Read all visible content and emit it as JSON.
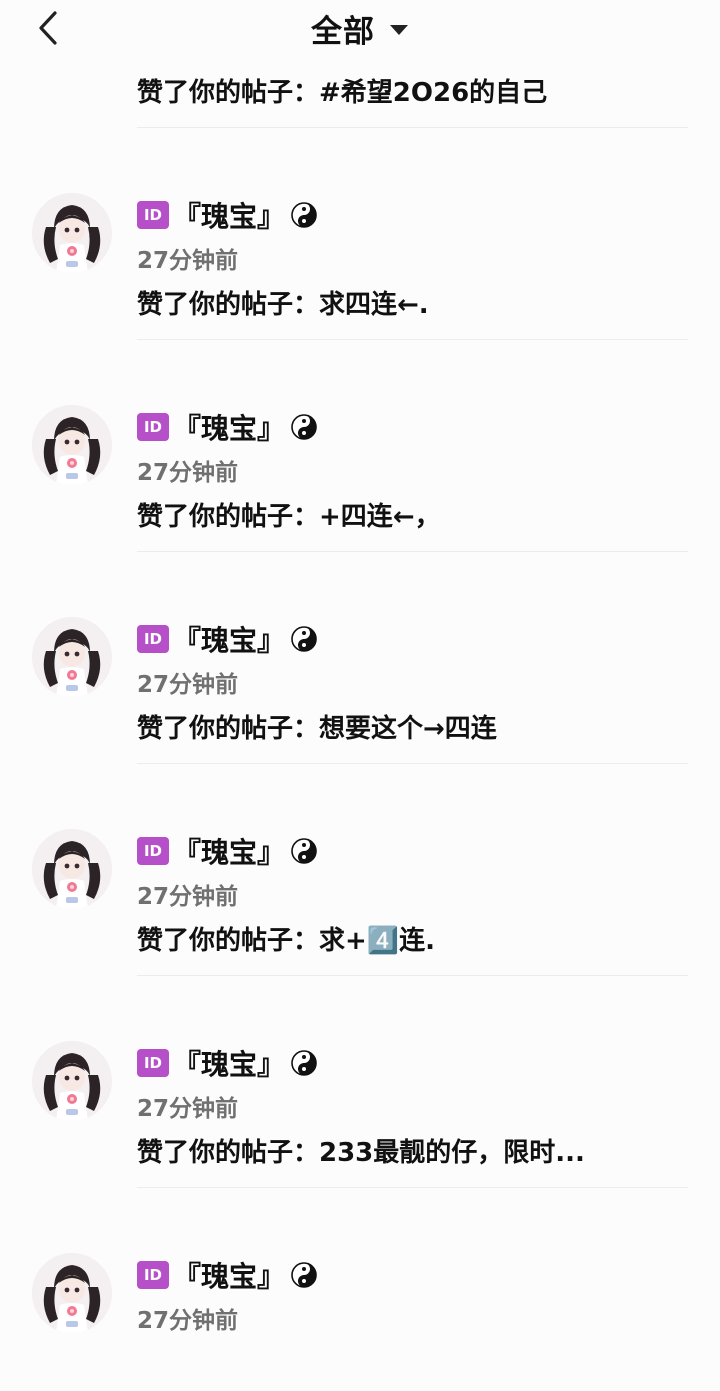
{
  "header": {
    "title": "全部"
  },
  "items": [
    {
      "id_badge": "ID",
      "name": "『瑰宝』",
      "time": "27分钟前",
      "content": "赞了你的帖子：#希望2O26的自己"
    },
    {
      "id_badge": "ID",
      "name": "『瑰宝』",
      "time": "27分钟前",
      "content": "赞了你的帖子：求四连←."
    },
    {
      "id_badge": "ID",
      "name": "『瑰宝』",
      "time": "27分钟前",
      "content": "赞了你的帖子：+四连←，"
    },
    {
      "id_badge": "ID",
      "name": "『瑰宝』",
      "time": "27分钟前",
      "content": "赞了你的帖子：想要这个→四连"
    },
    {
      "id_badge": "ID",
      "name": "『瑰宝』",
      "time": "27分钟前",
      "content": "赞了你的帖子：求+4️⃣连."
    },
    {
      "id_badge": "ID",
      "name": "『瑰宝』",
      "time": "27分钟前",
      "content": "赞了你的帖子：233最靓的仔，限时..."
    },
    {
      "id_badge": "ID",
      "name": "『瑰宝』",
      "time": "27分钟前",
      "content": ""
    }
  ],
  "colors": {
    "badge": "#b550c8",
    "time_text": "#707070",
    "divider": "#ececec"
  },
  "icons": {
    "back": "chevron-left-icon",
    "dropdown": "caret-down-icon",
    "symbol": "yin-yang-icon"
  }
}
